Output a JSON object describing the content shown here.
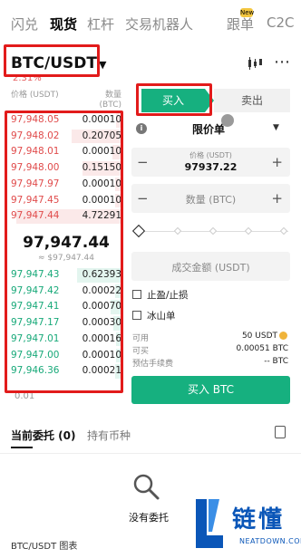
{
  "nav": {
    "tabs": [
      "闪兑",
      "现货",
      "杠杆",
      "交易机器人",
      "跟单",
      "C2C"
    ],
    "active": "现货",
    "badge": "New"
  },
  "pair": {
    "symbol": "BTC/USDT",
    "change": "2.31%"
  },
  "orderbook": {
    "price_header": "价格\n(USDT)",
    "qty_header": "数量\n(BTC)",
    "asks": [
      {
        "price": "97,948.05",
        "qty": "0.00010",
        "depth": 0.05
      },
      {
        "price": "97,948.02",
        "qty": "0.20705",
        "depth": 0.45
      },
      {
        "price": "97,948.01",
        "qty": "0.00010",
        "depth": 0.08
      },
      {
        "price": "97,948.00",
        "qty": "0.15150",
        "depth": 0.35
      },
      {
        "price": "97,947.97",
        "qty": "0.00010",
        "depth": 0.06
      },
      {
        "price": "97,947.45",
        "qty": "0.00010",
        "depth": 0.06
      },
      {
        "price": "97,947.44",
        "qty": "4.72291",
        "depth": 0.95
      }
    ],
    "mid_price": "97,947.44",
    "mid_sub": "≈ $97,947.44",
    "bids": [
      {
        "price": "97,947.43",
        "qty": "0.62393",
        "depth": 0.4
      },
      {
        "price": "97,947.42",
        "qty": "0.00022",
        "depth": 0.06
      },
      {
        "price": "97,947.41",
        "qty": "0.00070",
        "depth": 0.1
      },
      {
        "price": "97,947.17",
        "qty": "0.00030",
        "depth": 0.07
      },
      {
        "price": "97,947.01",
        "qty": "0.00016",
        "depth": 0.05
      },
      {
        "price": "97,947.00",
        "qty": "0.00010",
        "depth": 0.05
      },
      {
        "price": "97,946.36",
        "qty": "0.00021",
        "depth": 0.06
      }
    ],
    "precision": "0.01"
  },
  "form": {
    "buy_tab": "买入",
    "sell_tab": "卖出",
    "order_type": "限价单",
    "price_label": "价格 (USDT)",
    "price_value": "97937.22",
    "qty_placeholder": "数量 (BTC)",
    "amount_placeholder": "成交金额 (USDT)",
    "tp_sl": "止盈/止损",
    "iceberg": "冰山单",
    "available_label": "可用",
    "available_value": "50 USDT",
    "can_buy_label": "可买",
    "can_buy_value": "0.00051 BTC",
    "fee_label": "预估手续费",
    "fee_value": "-- BTC",
    "submit": "买入 BTC"
  },
  "bottom": {
    "tab_orders": "当前委托 (0)",
    "tab_holdings": "持有币种",
    "empty_text": "没有委托",
    "chart_link": "BTC/USDT 图表"
  },
  "watermark": {
    "brand": "链懂",
    "site": "NEATDOWN.COM"
  },
  "colors": {
    "buy": "#16b07f",
    "sell": "#e04b4b",
    "highlight_box": "#e21b1b",
    "watermark": "#0a56b8"
  }
}
